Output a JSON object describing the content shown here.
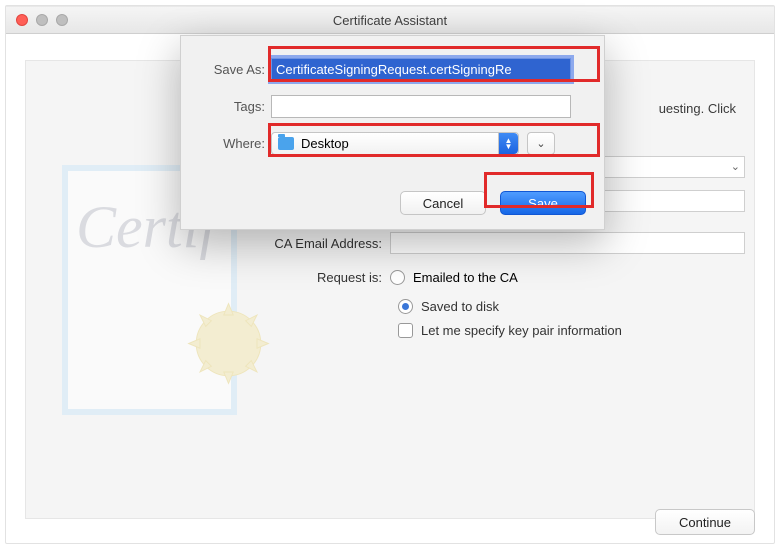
{
  "window": {
    "title": "Certificate Assistant"
  },
  "bg": {
    "info_partial_1": "uesting. Click",
    "cert_script": "Certif"
  },
  "under": {
    "dropdown_value": "",
    "input_value": "",
    "ca_email_label": "CA Email Address:",
    "request_is_label": "Request is:",
    "opt_email": "Emailed to the CA",
    "opt_disk": "Saved to disk",
    "opt_keypair": "Let me specify key pair information"
  },
  "sheet": {
    "saveas_label": "Save As:",
    "saveas_value": "CertificateSigningRequest.certSigningRe",
    "tags_label": "Tags:",
    "tags_value": "",
    "where_label": "Where:",
    "where_value": "Desktop",
    "cancel": "Cancel",
    "save": "Save"
  },
  "footer": {
    "continue": "Continue"
  }
}
